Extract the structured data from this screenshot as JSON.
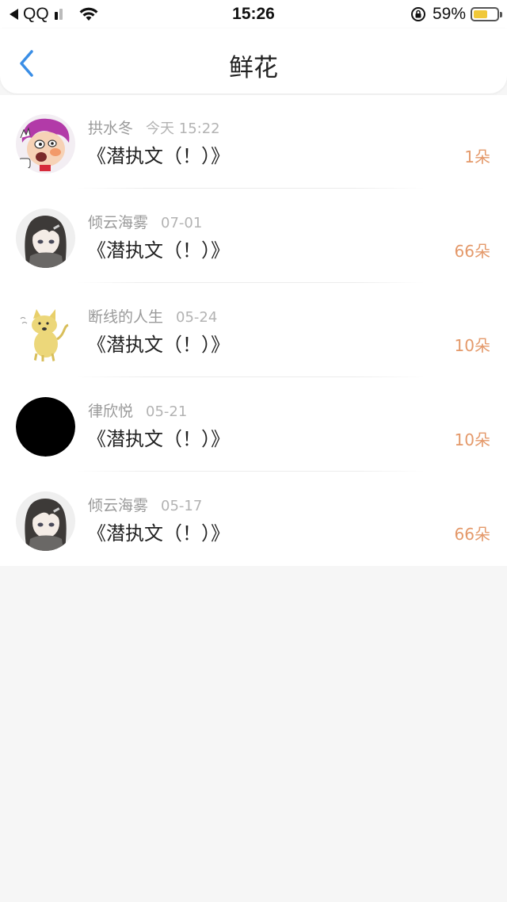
{
  "status_bar": {
    "back_app": "QQ",
    "time": "15:26",
    "battery": "59%",
    "battery_level": 0.59,
    "icons": [
      "back-triangle-icon",
      "signal-icon",
      "wifi-icon",
      "rotation-lock-icon",
      "battery-icon"
    ]
  },
  "nav": {
    "title": "鲜花",
    "back_icon": "chevron-left-icon",
    "accent": "#3a8ee6"
  },
  "gifts": [
    {
      "user": "拱水冬",
      "date": "今天 15:22",
      "content": "《潜执文（！）》",
      "amount": "1朵",
      "avatar": "cartoon-boy"
    },
    {
      "user": "倾云海雾",
      "date": "07-01",
      "content": "《潜执文（！）》",
      "amount": "66朵",
      "avatar": "anime-girl"
    },
    {
      "user": "断线的人生",
      "date": "05-24",
      "content": "《潜执文（！）》",
      "amount": "10朵",
      "avatar": "doge"
    },
    {
      "user": "律欣悦",
      "date": "05-21",
      "content": "《潜执文（！）》",
      "amount": "10朵",
      "avatar": "black-circle"
    },
    {
      "user": "倾云海雾",
      "date": "05-17",
      "content": "《潜执文（！）》",
      "amount": "66朵",
      "avatar": "anime-girl"
    }
  ],
  "colors": {
    "amount": "#e4996a",
    "meta": "#9a9a9a",
    "background": "#f6f6f6"
  }
}
